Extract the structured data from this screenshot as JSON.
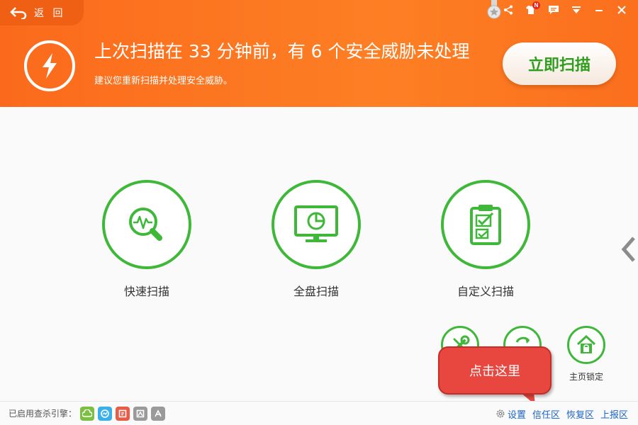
{
  "header": {
    "back_label": "返 回",
    "headline": "上次扫描在 33 分钟前，有 6 个安全威胁未处理",
    "subline": "建议您重新扫描并处理安全威胁。",
    "scan_now_label": "立即扫描",
    "notification_badge": "N",
    "colors": {
      "bg": "#fd7f24",
      "accent_green": "#2f9e1e"
    }
  },
  "top_icons": [
    "medal-icon",
    "share-icon",
    "skin-icon",
    "message-icon",
    "menu-icon",
    "minimize-icon",
    "close-icon"
  ],
  "scan_options": [
    {
      "label": "快速扫描",
      "icon": "quick-scan-icon"
    },
    {
      "label": "全盘扫描",
      "icon": "full-scan-icon"
    },
    {
      "label": "自定义扫描",
      "icon": "custom-scan-icon"
    }
  ],
  "tools": [
    {
      "label": "",
      "icon": "repair-tools-icon"
    },
    {
      "label": "",
      "icon": "refresh-icon"
    },
    {
      "label": "主页锁定",
      "icon": "home-lock-icon"
    }
  ],
  "callout": {
    "text": "点击这里"
  },
  "footer": {
    "engines_label": "已启用查杀引擎：",
    "engines": [
      {
        "icon": "cloud-engine-icon",
        "color": "#7bc043"
      },
      {
        "icon": "qvm-engine-icon",
        "color": "#3bb0e8"
      },
      {
        "icon": "qex-engine-icon",
        "color": "#e85b47"
      },
      {
        "icon": "avira-engine-icon",
        "color": "#9a9a9a"
      },
      {
        "icon": "bitdefender-engine-icon",
        "color": "#9a9a9a"
      }
    ],
    "settings_label": "设置",
    "links": [
      "信任区",
      "恢复区",
      "上报区"
    ]
  }
}
